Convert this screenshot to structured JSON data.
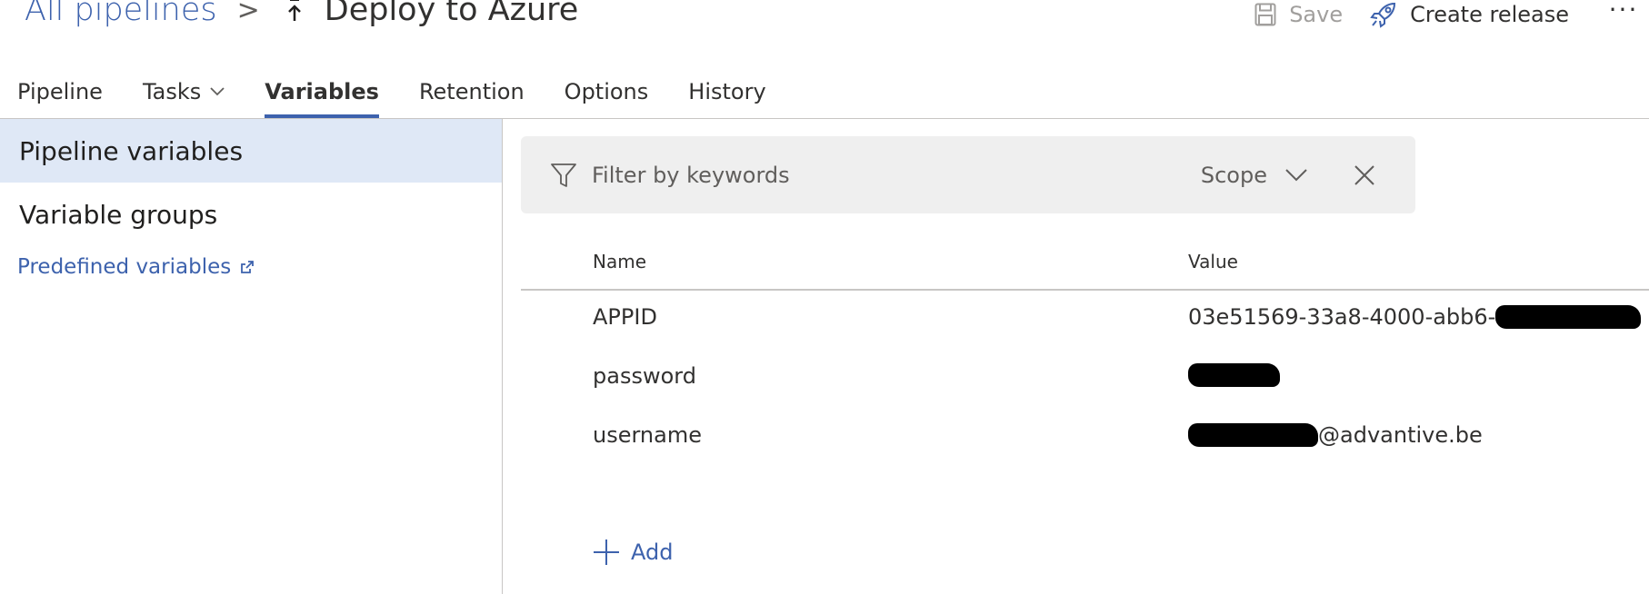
{
  "header": {
    "breadcrumb_root": "All pipelines",
    "breadcrumb_separator": ">",
    "title": "Deploy to Azure",
    "save_label": "Save",
    "create_release_label": "Create release",
    "more_label": "···"
  },
  "tabs": [
    {
      "label": "Pipeline"
    },
    {
      "label": "Tasks"
    },
    {
      "label": "Variables"
    },
    {
      "label": "Retention"
    },
    {
      "label": "Options"
    },
    {
      "label": "History"
    }
  ],
  "active_tab": "Variables",
  "sidebar": {
    "items": [
      {
        "label": "Pipeline variables"
      },
      {
        "label": "Variable groups"
      }
    ],
    "link_label": "Predefined variables"
  },
  "filter": {
    "placeholder": "Filter by keywords",
    "scope_label": "Scope"
  },
  "table": {
    "columns": [
      "Name",
      "Value"
    ],
    "rows": [
      {
        "name": "APPID",
        "value": "03e51569-33a8-4000-abb6-"
      },
      {
        "name": "password",
        "value": ""
      },
      {
        "name": "username",
        "value": "@advantive.be"
      }
    ]
  },
  "add_label": "Add",
  "colors": {
    "accent": "#3d62ad",
    "selected_bg": "#dfe8f6",
    "filter_bg": "#efefef",
    "redaction": "#000000"
  },
  "icons": {
    "pipeline": "pipeline-release-icon",
    "save": "floppy-disk-icon",
    "release": "rocket-icon",
    "filter": "funnel-icon",
    "scope": "chevron-down-icon",
    "clear": "close-icon",
    "external": "external-link-icon",
    "add": "plus-icon"
  }
}
